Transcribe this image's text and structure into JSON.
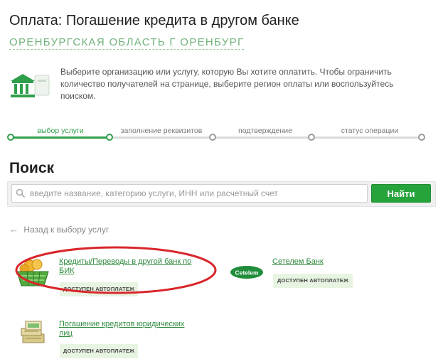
{
  "header": {
    "title": "Оплата: Погашение кредита в другом банке",
    "region": "ОРЕНБУРГСКАЯ ОБЛАСТЬ Г ОРЕНБУРГ"
  },
  "intro": {
    "text": "Выберите организацию или услугу, которую Вы хотите оплатить. Чтобы ограничить количество получателей на странице, выберите регион оплаты или воспользуйтесь поиском.",
    "icon": "bank-icon"
  },
  "steps": [
    {
      "label": "выбор услуги",
      "active": true
    },
    {
      "label": "заполнение реквизитов",
      "active": false
    },
    {
      "label": "подтверждение",
      "active": false
    },
    {
      "label": "статус операции",
      "active": false
    }
  ],
  "search": {
    "heading": "Поиск",
    "placeholder": "введите название, категорию услуги, ИНН или расчетный счет",
    "button": "Найти"
  },
  "back_link": {
    "arrow": "←",
    "label": "Назад к выбору услуг"
  },
  "services": [
    {
      "title": "Кредиты/Переводы в другой банк по БИК",
      "badge": "ДОСТУПЕН АВТОПЛАТЕЖ",
      "icon": "basket-coins-icon"
    },
    {
      "title": "Сетелем Банк",
      "badge": "ДОСТУПЕН АВТОПЛАТЕЖ",
      "icon": "cetelem-logo",
      "logo_text": "Cetelem"
    },
    {
      "title": "Погашение кредитов юридических лиц",
      "badge": "ДОСТУПЕН АВТОПЛАТЕЖ",
      "icon": "money-stack-icon"
    }
  ],
  "colors": {
    "accent": "#27a33c",
    "link": "#2f8a3e",
    "annotation": "#d9262b"
  }
}
